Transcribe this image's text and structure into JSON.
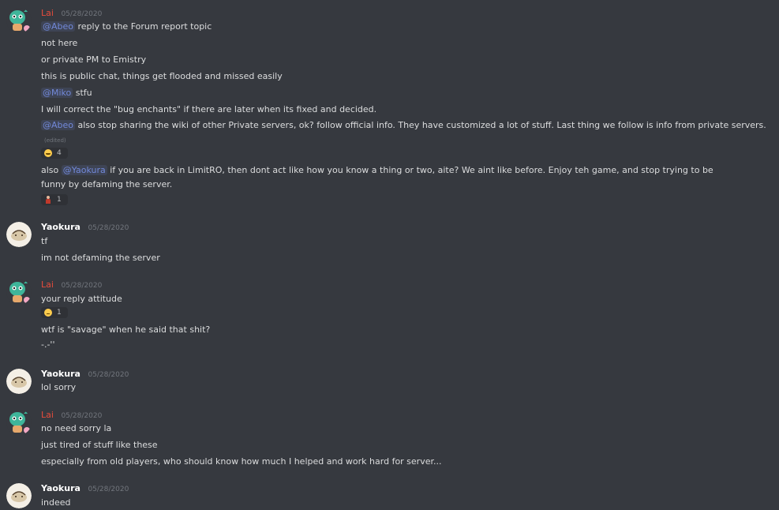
{
  "users": {
    "lai": "Lai",
    "yaokura": "Yaokura"
  },
  "colors": {
    "background": "#36393f",
    "lai_name": "#e74c3c",
    "mention": "#7289da",
    "timestamp": "#72767d"
  },
  "groups": [
    {
      "author": "Lai",
      "timestamp": "05/28/2020",
      "lines": [
        {
          "mention": "@Abeo",
          "text": " reply to the Forum report topic"
        },
        {
          "text": "not here"
        },
        {
          "text": "or private PM to Emistry"
        },
        {
          "text": "this is public chat, things get flooded and missed easily"
        },
        {
          "mention": "@Miko",
          "text": " stfu"
        },
        {
          "text": "I will correct the \"bug enchants\" if there are later when its fixed and decided."
        },
        {
          "mention": "@Abeo",
          "text": "  also stop sharing the wiki of other Private servers, ok? follow official info. They have customized a lot of stuff. Last thing we follow is info from private servers.",
          "edited": "(edited)",
          "reaction": {
            "emoji": "joy-emoji",
            "count": "4"
          }
        },
        {
          "prefix": "also ",
          "mention": "@Yaokura",
          "text": " if you are back in LimitRO, then dont act like how you know a thing or two, aite? We aint like before. Enjoy teh game, and stop trying to be funny by defaming the server.",
          "reaction": {
            "emoji": "person-emoji",
            "count": "1"
          }
        }
      ]
    },
    {
      "author": "Yaokura",
      "timestamp": "05/28/2020",
      "lines": [
        {
          "text": "tf"
        },
        {
          "text": "im not defaming the server"
        }
      ]
    },
    {
      "author": "Lai",
      "timestamp": "05/28/2020",
      "lines": [
        {
          "text": "your reply attitude",
          "reaction": {
            "emoji": "relieved-emoji",
            "count": "1"
          }
        },
        {
          "text": "wtf is \"savage\" when he said that shit?"
        },
        {
          "text": "-.-''"
        }
      ]
    },
    {
      "author": "Yaokura",
      "timestamp": "05/28/2020",
      "lines": [
        {
          "text": "lol sorry"
        }
      ]
    },
    {
      "author": "Lai",
      "timestamp": "05/28/2020",
      "lines": [
        {
          "text": "no need sorry la"
        },
        {
          "text": "just tired of stuff like these"
        },
        {
          "text": "especially from old players, who should know how much I helped and work hard for server..."
        }
      ]
    },
    {
      "author": "Yaokura",
      "timestamp": "05/28/2020",
      "lines": [
        {
          "text": "indeed"
        }
      ]
    }
  ]
}
